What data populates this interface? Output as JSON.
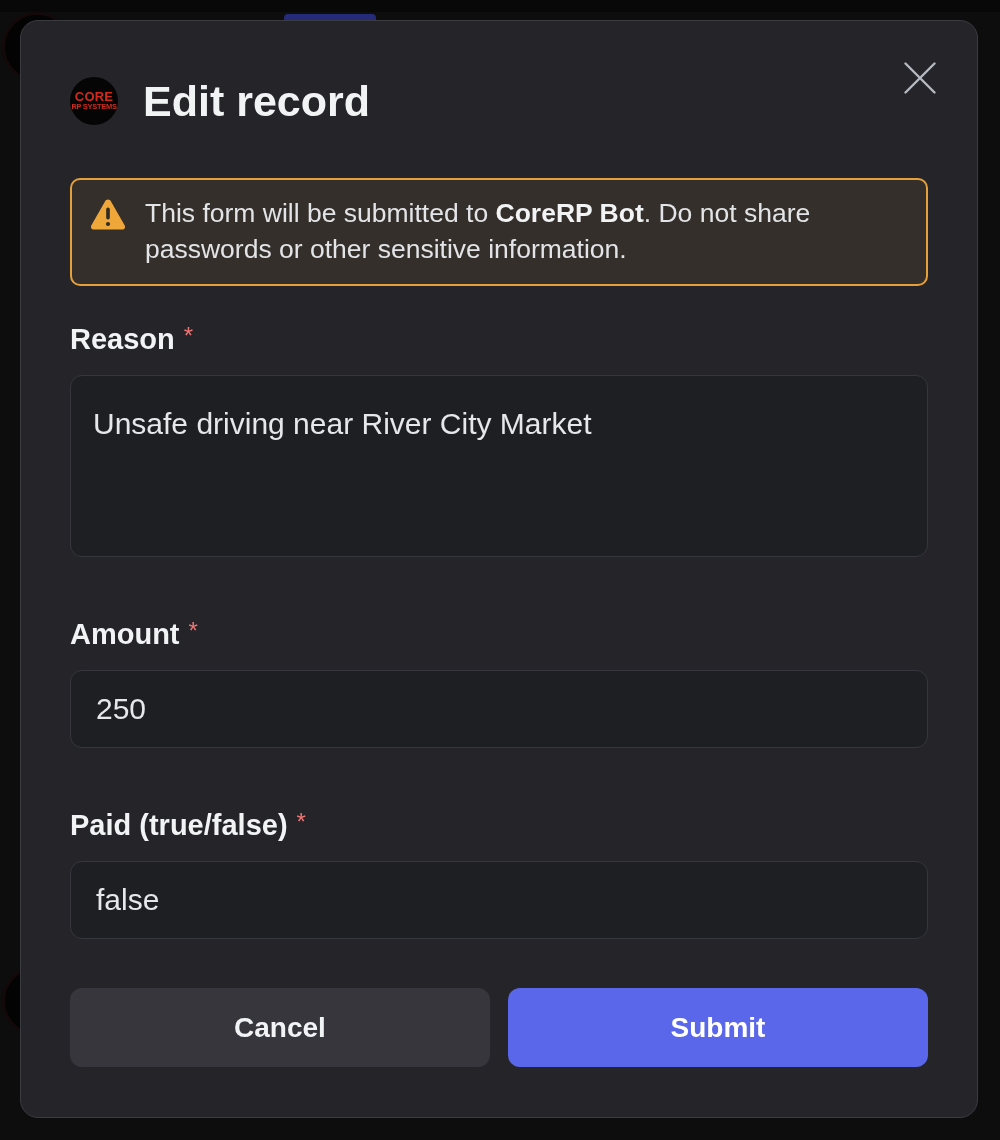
{
  "modal": {
    "logo": {
      "wordmark": "CORE",
      "tagline": "RP SYSTEMS"
    },
    "title": "Edit record"
  },
  "notice": {
    "text": "This form will be submitted to **CoreRP Bot**. Do not share passwords or other sensitive information."
  },
  "fields": [
    {
      "kind": "multiline",
      "label": "Reason",
      "required_mark": "*",
      "value": "Unsafe driving near River City Market"
    },
    {
      "kind": "single",
      "label": "Amount",
      "required_mark": "*",
      "value": "250"
    },
    {
      "kind": "single",
      "label": "Paid (true/false)",
      "required_mark": "*",
      "value": "false"
    }
  ],
  "buttons": [
    {
      "kind": "secondary",
      "label": "Cancel"
    },
    {
      "kind": "primary",
      "label": "Submit"
    }
  ]
}
